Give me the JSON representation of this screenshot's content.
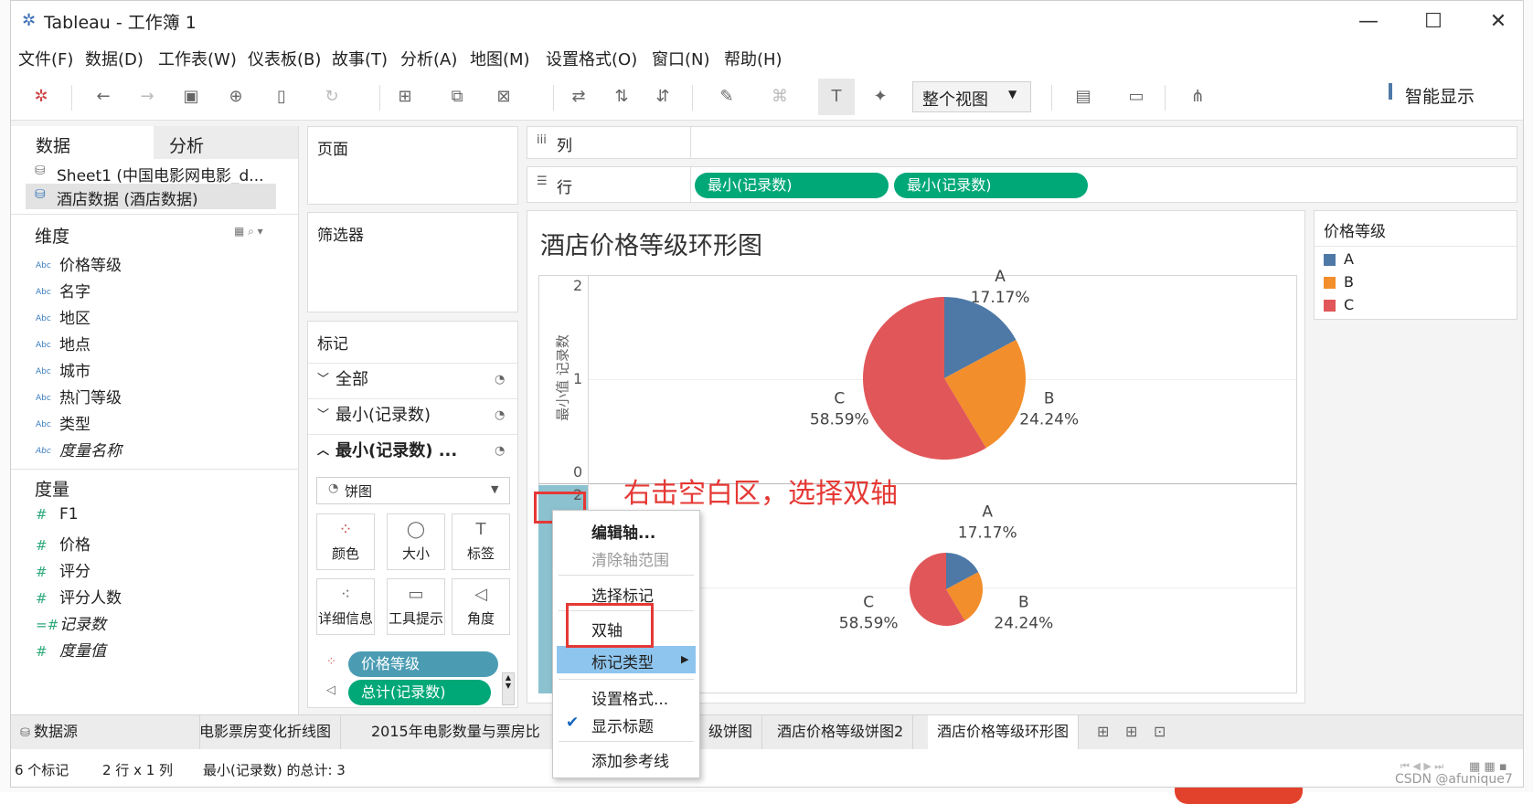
{
  "window": {
    "title": "Tableau - 工作簿 1",
    "controls": [
      "—",
      "☐",
      "✕"
    ]
  },
  "menu": [
    "文件(F)",
    "数据(D)",
    "工作表(W)",
    "仪表板(B)",
    "故事(T)",
    "分析(A)",
    "地图(M)",
    "设置格式(O)",
    "窗口(N)",
    "帮助(H)"
  ],
  "toolbar": {
    "view_select": "整个视图",
    "smart_show": "智能显示"
  },
  "left": {
    "tabs": [
      "数据",
      "分析"
    ],
    "datasources": [
      "Sheet1 (中国电影网电影_d...",
      "酒店数据 (酒店数据)"
    ],
    "dimensions_title": "维度",
    "dimensions": [
      "价格等级",
      "名字",
      "地区",
      "地点",
      "城市",
      "热门等级",
      "类型",
      "度量名称"
    ],
    "measures_title": "度量",
    "measures": [
      "F1",
      "价格",
      "评分",
      "评分人数",
      "记录数",
      "度量值"
    ]
  },
  "shelves": {
    "pages": "页面",
    "filters": "筛选器",
    "columns": "列",
    "rows": "行",
    "row_pills": [
      "最小(记录数)",
      "最小(记录数)"
    ]
  },
  "marks": {
    "title": "标记",
    "rows": [
      "全部",
      "最小(记录数)",
      "最小(记录数) ..."
    ],
    "mark_type": "饼图",
    "buttons": [
      "颜色",
      "大小",
      "标签",
      "详细信息",
      "工具提示",
      "角度"
    ],
    "pills": [
      "价格等级",
      "总计(记录数)"
    ]
  },
  "view": {
    "title": "酒店价格等级环形图",
    "axis_title": "最小值 记录数",
    "axis_ticks_top": [
      "2",
      "1",
      "0"
    ],
    "axis_ticks_bottom": [
      "2"
    ],
    "annotation": "右击空白区，选择双轴"
  },
  "chart_data": {
    "type": "pie",
    "categories": [
      "A",
      "B",
      "C"
    ],
    "values": [
      17.17,
      24.24,
      58.59
    ],
    "labels": [
      "17.17%",
      "24.24%",
      "58.59%"
    ],
    "colors": [
      "#4e79a7",
      "#f28e2b",
      "#e15759"
    ]
  },
  "legend": {
    "title": "价格等级",
    "items": [
      "A",
      "B",
      "C"
    ]
  },
  "context_menu": [
    "编辑轴...",
    "清除轴范围",
    "选择标记",
    "双轴",
    "标记类型",
    "设置格式...",
    "显示标题",
    "添加参考线"
  ],
  "tabs": [
    "数据源",
    "电影票房变化折线图",
    "2015年电影数量与票房比",
    "级饼图",
    "酒店价格等级饼图2",
    "酒店价格等级环形图"
  ],
  "status": [
    "6 个标记",
    "2 行 x 1 列",
    "最小(记录数) 的总计: 3"
  ],
  "watermark": "CSDN @afunique7"
}
